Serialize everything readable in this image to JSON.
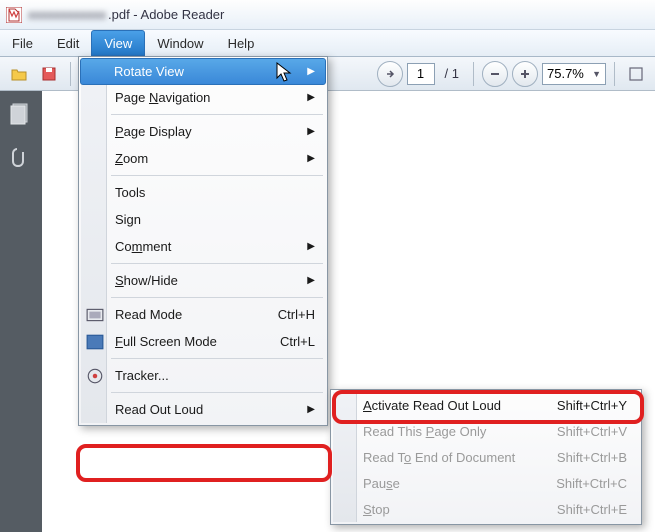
{
  "title": {
    "filename_blurred": "xxxxxxxxxxxx",
    "suffix": ".pdf - Adobe Reader"
  },
  "menubar": {
    "file": "File",
    "edit": "Edit",
    "view": "View",
    "window": "Window",
    "help": "Help"
  },
  "toolbar": {
    "page_current": "1",
    "page_total": "/ 1",
    "zoom_value": "75.7%"
  },
  "view_menu": {
    "rotate_view": "Rotate View",
    "page_navigation": "Page Navigation",
    "page_display": "Page Display",
    "zoom": "Zoom",
    "tools": "Tools",
    "sign": "Sign",
    "comment": "Comment",
    "show_hide": "Show/Hide",
    "read_mode": "Read Mode",
    "read_mode_sc": "Ctrl+H",
    "full_screen": "Full Screen Mode",
    "full_screen_sc": "Ctrl+L",
    "tracker": "Tracker...",
    "read_out_loud": "Read Out Loud"
  },
  "submenu": {
    "activate": "Activate Read Out Loud",
    "activate_sc": "Shift+Ctrl+Y",
    "page_only": "Read This Page Only",
    "page_only_sc": "Shift+Ctrl+V",
    "to_end": "Read To End of Document",
    "to_end_sc": "Shift+Ctrl+B",
    "pause": "Pause",
    "pause_sc": "Shift+Ctrl+C",
    "stop": "Stop",
    "stop_sc": "Shift+Ctrl+E"
  }
}
